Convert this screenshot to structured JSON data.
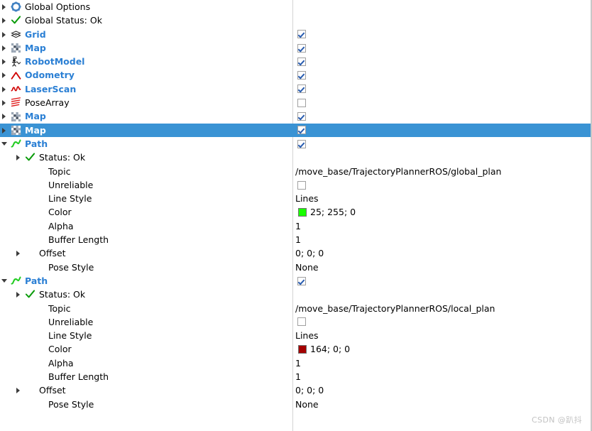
{
  "panel": {
    "title": "RViz Displays Panel",
    "selected_row_index": 8,
    "colors": {
      "selection": "#3a93d4",
      "display_name": "#2a7fd4",
      "checkbox_tick": "#2a5db0",
      "divider": "#d3d3d3"
    }
  },
  "watermark": {
    "text": "CSDN @趴抖"
  },
  "rows": [
    {
      "label": "Global Options",
      "icon": "gear-icon",
      "style": "plain",
      "indent": 1,
      "twisty": "right",
      "value_type": "none"
    },
    {
      "label": "Global Status: Ok",
      "icon": "check-icon",
      "style": "plain",
      "indent": 1,
      "twisty": "right",
      "value_type": "none"
    },
    {
      "label": "Grid",
      "icon": "grid-icon",
      "style": "blue",
      "indent": 1,
      "twisty": "right",
      "value_type": "checkbox",
      "checked": true
    },
    {
      "label": "Map",
      "icon": "map-icon",
      "style": "blue",
      "indent": 1,
      "twisty": "right",
      "value_type": "checkbox",
      "checked": true
    },
    {
      "label": "RobotModel",
      "icon": "robot-icon",
      "style": "blue",
      "indent": 1,
      "twisty": "right",
      "value_type": "checkbox",
      "checked": true
    },
    {
      "label": "Odometry",
      "icon": "odometry-icon",
      "style": "blue",
      "indent": 1,
      "twisty": "right",
      "value_type": "checkbox",
      "checked": true
    },
    {
      "label": "LaserScan",
      "icon": "laserscan-icon",
      "style": "blue",
      "indent": 1,
      "twisty": "right",
      "value_type": "checkbox",
      "checked": true
    },
    {
      "label": "PoseArray",
      "icon": "posearray-icon",
      "style": "plain",
      "indent": 1,
      "twisty": "right",
      "value_type": "checkbox",
      "checked": false
    },
    {
      "label": "Map",
      "icon": "map-icon",
      "style": "blue",
      "indent": 1,
      "twisty": "right",
      "value_type": "checkbox",
      "checked": true
    },
    {
      "label": "Map",
      "icon": "map-icon",
      "style": "blue",
      "indent": 1,
      "twisty": "right",
      "value_type": "checkbox",
      "checked": true,
      "selected": true
    },
    {
      "label": "Path",
      "icon": "path-icon",
      "style": "blue",
      "indent": 1,
      "twisty": "down",
      "value_type": "checkbox",
      "checked": true
    },
    {
      "label": "Status: Ok",
      "icon": "check-icon",
      "style": "plain",
      "indent": 2,
      "twisty": "right",
      "value_type": "none"
    },
    {
      "label": "Topic",
      "icon": "none",
      "style": "plain",
      "indent": 3,
      "twisty": "none",
      "value_type": "text",
      "value": "/move_base/TrajectoryPlannerROS/global_plan"
    },
    {
      "label": "Unreliable",
      "icon": "none",
      "style": "plain",
      "indent": 3,
      "twisty": "none",
      "value_type": "checkbox",
      "checked": false
    },
    {
      "label": "Line Style",
      "icon": "none",
      "style": "plain",
      "indent": 3,
      "twisty": "none",
      "value_type": "text",
      "value": "Lines"
    },
    {
      "label": "Color",
      "icon": "none",
      "style": "plain",
      "indent": 3,
      "twisty": "none",
      "value_type": "color",
      "value": "25; 255; 0",
      "swatch": "#19ff00"
    },
    {
      "label": "Alpha",
      "icon": "none",
      "style": "plain",
      "indent": 3,
      "twisty": "none",
      "value_type": "text",
      "value": "1"
    },
    {
      "label": "Buffer Length",
      "icon": "none",
      "style": "plain",
      "indent": 3,
      "twisty": "none",
      "value_type": "text",
      "value": "1"
    },
    {
      "label": "Offset",
      "icon": "none",
      "style": "plain",
      "indent": 2,
      "twisty": "right",
      "value_type": "text",
      "value": "0; 0; 0"
    },
    {
      "label": "Pose Style",
      "icon": "none",
      "style": "plain",
      "indent": 3,
      "twisty": "none",
      "value_type": "text",
      "value": "None"
    },
    {
      "label": "Path",
      "icon": "path-icon",
      "style": "blue",
      "indent": 1,
      "twisty": "down",
      "value_type": "checkbox",
      "checked": true
    },
    {
      "label": "Status: Ok",
      "icon": "check-icon",
      "style": "plain",
      "indent": 2,
      "twisty": "right",
      "value_type": "none"
    },
    {
      "label": "Topic",
      "icon": "none",
      "style": "plain",
      "indent": 3,
      "twisty": "none",
      "value_type": "text",
      "value": "/move_base/TrajectoryPlannerROS/local_plan"
    },
    {
      "label": "Unreliable",
      "icon": "none",
      "style": "plain",
      "indent": 3,
      "twisty": "none",
      "value_type": "checkbox",
      "checked": false
    },
    {
      "label": "Line Style",
      "icon": "none",
      "style": "plain",
      "indent": 3,
      "twisty": "none",
      "value_type": "text",
      "value": "Lines"
    },
    {
      "label": "Color",
      "icon": "none",
      "style": "plain",
      "indent": 3,
      "twisty": "none",
      "value_type": "color",
      "value": "164; 0; 0",
      "swatch": "#a40000"
    },
    {
      "label": "Alpha",
      "icon": "none",
      "style": "plain",
      "indent": 3,
      "twisty": "none",
      "value_type": "text",
      "value": "1"
    },
    {
      "label": "Buffer Length",
      "icon": "none",
      "style": "plain",
      "indent": 3,
      "twisty": "none",
      "value_type": "text",
      "value": "1"
    },
    {
      "label": "Offset",
      "icon": "none",
      "style": "plain",
      "indent": 2,
      "twisty": "right",
      "value_type": "text",
      "value": "0; 0; 0"
    },
    {
      "label": "Pose Style",
      "icon": "none",
      "style": "plain",
      "indent": 3,
      "twisty": "none",
      "value_type": "text",
      "value": "None"
    }
  ]
}
